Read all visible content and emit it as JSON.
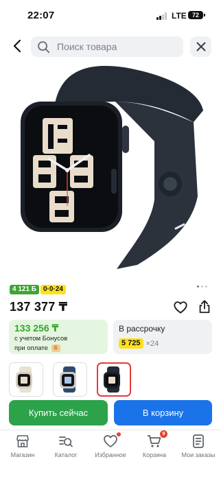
{
  "status_bar": {
    "time": "22:07",
    "network": "LTE",
    "battery": "72"
  },
  "search": {
    "placeholder": "Поиск товара"
  },
  "badges": {
    "bonus": "4 121 Б",
    "installment": "0·0·24"
  },
  "product": {
    "price": "137 377 ₸"
  },
  "bonus_card": {
    "price": "133 256 ₸",
    "line1": "с учетом Бонусов",
    "line2": "при оплате"
  },
  "credit_card": {
    "title": "В рассрочку",
    "amount": "5 725",
    "months": "×24"
  },
  "variants": [
    {
      "name": "starlight",
      "selected": false
    },
    {
      "name": "blue",
      "selected": false
    },
    {
      "name": "midnight",
      "selected": true
    }
  ],
  "actions": {
    "buy_now": "Купить сейчас",
    "add_to_cart": "В корзину"
  },
  "nav": {
    "items": [
      {
        "label": "Магазин",
        "icon": "store-icon"
      },
      {
        "label": "Каталог",
        "icon": "catalog-search-icon"
      },
      {
        "label": "Избранное",
        "icon": "heart-icon"
      },
      {
        "label": "Корзина",
        "icon": "cart-icon",
        "count": "9"
      },
      {
        "label": "Мои заказы",
        "icon": "orders-icon"
      }
    ]
  },
  "colors": {
    "green": "#2ca24a",
    "blue": "#1a73e8",
    "yellow": "#ffe11b",
    "red": "#e8412f"
  }
}
